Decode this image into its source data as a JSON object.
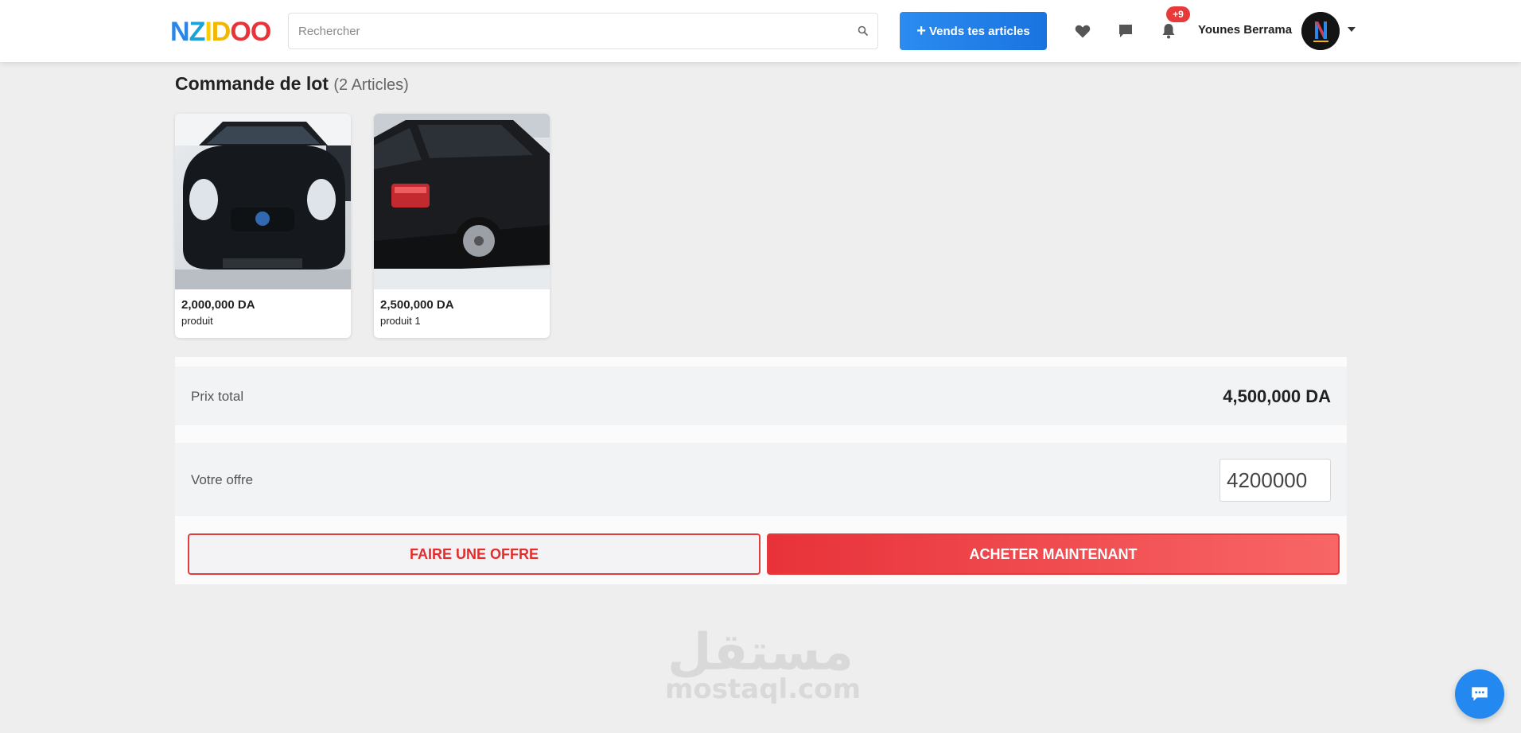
{
  "header": {
    "logo_letters": [
      {
        "char": "N",
        "color": "#2a86e8"
      },
      {
        "char": "Z",
        "color": "#1aa3d9"
      },
      {
        "char": "I",
        "color": "#ffcc00"
      },
      {
        "char": "D",
        "color": "#f2b705"
      },
      {
        "char": "O",
        "color": "#e8333a"
      },
      {
        "char": "O",
        "color": "#e8333a"
      }
    ],
    "search_placeholder": "Rechercher",
    "sell_button_icon": "+",
    "sell_button_label": "Vends tes articles",
    "notifications_badge": "+9",
    "username": "Younes Berrama",
    "icons": [
      "heart-icon",
      "chat-bubble-icon",
      "bell-icon",
      "search-icon",
      "caret-down-icon"
    ]
  },
  "order": {
    "title": "Commande de lot",
    "count_label": "(2 Articles)",
    "items": [
      {
        "price": "2,000,000 DA",
        "name": "produit"
      },
      {
        "price": "2,500,000 DA",
        "name": "produit 1"
      }
    ]
  },
  "summary": {
    "total_label": "Prix total",
    "total_value": "4,500,000 DA",
    "offer_label": "Votre offre",
    "offer_value": "4200000",
    "make_offer_button": "FAIRE UNE OFFRE",
    "buy_now_button": "ACHETER MAINTENANT"
  },
  "watermark": {
    "arabic": "مستقل",
    "latin": "mostaql.com"
  },
  "colors": {
    "primary_blue": "#1a73e0",
    "accent_red": "#e23c3c",
    "badge_red": "#e83a3a",
    "page_bg": "#eeeeef"
  }
}
